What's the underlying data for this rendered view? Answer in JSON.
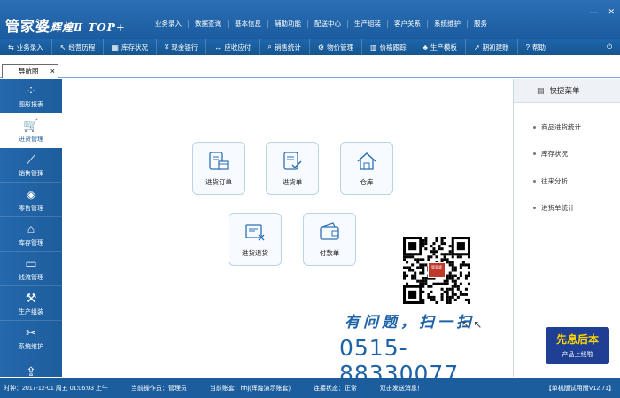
{
  "app": {
    "logo_main": "管家婆",
    "logo_sub": "辉煌Ⅱ TOP+"
  },
  "topnav": [
    "业务录入",
    "数据查询",
    "基本信息",
    "辅助功能",
    "配送中心",
    "生产组装",
    "客户关系",
    "系统维护",
    "服务"
  ],
  "toolbar": [
    {
      "icon": "clipboard-icon",
      "glyph": "⇆",
      "label": "业务录入"
    },
    {
      "icon": "route-icon",
      "glyph": "↖",
      "label": "经营历程"
    },
    {
      "icon": "warehouse-icon",
      "glyph": "▦",
      "label": "库存状况"
    },
    {
      "icon": "yen-icon",
      "glyph": "¥",
      "label": "现金银行"
    },
    {
      "icon": "exchange-icon",
      "glyph": "↔",
      "label": "应收应付"
    },
    {
      "icon": "search-icon",
      "glyph": "⌕",
      "label": "销售统计"
    },
    {
      "icon": "gear-icon",
      "glyph": "⚙",
      "label": "物价管理"
    },
    {
      "icon": "chart-icon",
      "glyph": "▥",
      "label": "价格跟踪"
    },
    {
      "icon": "sitemap-icon",
      "glyph": "♣",
      "label": "生产模板"
    },
    {
      "icon": "external-icon",
      "glyph": "↗",
      "label": "期初建账"
    },
    {
      "icon": "help-icon",
      "glyph": "?",
      "label": "帮助"
    }
  ],
  "tab": {
    "label": "导航图",
    "close": "×"
  },
  "sidebar": [
    {
      "icon": "grid-icon",
      "glyph": "⁘",
      "label": "图形报表",
      "active": false
    },
    {
      "icon": "cart-icon",
      "glyph": "🛒",
      "label": "进货管理",
      "active": true
    },
    {
      "icon": "trend-icon",
      "glyph": "⟋",
      "label": "销售管理",
      "active": false
    },
    {
      "icon": "tag-icon",
      "glyph": "◈",
      "label": "零售管理",
      "active": false
    },
    {
      "icon": "house-icon",
      "glyph": "⌂",
      "label": "库存管理",
      "active": false
    },
    {
      "icon": "card-icon",
      "glyph": "▭",
      "label": "钱流管理",
      "active": false
    },
    {
      "icon": "wrench-icon",
      "glyph": "⚒",
      "label": "生产组装",
      "active": false
    },
    {
      "icon": "tools-icon",
      "glyph": "✂",
      "label": "系统维护",
      "active": false
    },
    {
      "icon": "upload-icon",
      "glyph": "⇪",
      "label": "",
      "active": false
    }
  ],
  "tiles": [
    {
      "name": "purchase-order",
      "label": "进货订单",
      "icon": "order-box-icon"
    },
    {
      "name": "purchase-bill",
      "label": "进货单",
      "icon": "checklist-icon"
    },
    {
      "name": "warehouse",
      "label": "仓库",
      "icon": "house-icon"
    },
    {
      "name": "purchase-return",
      "label": "进货退货",
      "icon": "return-doc-icon"
    },
    {
      "name": "payment-bill",
      "label": "付款单",
      "icon": "wallet-icon"
    }
  ],
  "promo": {
    "slogan": "有问题，扫一扫",
    "phone": "0515-88330077",
    "qr_badge": "管家婆",
    "arrows": "↖ ↖",
    "title": "先息后本",
    "subtitle": "产品上线啦"
  },
  "quickmenu": {
    "title": "快捷菜单",
    "items": [
      "商品进货统计",
      "库存状况",
      "往来分析",
      "进货单统计"
    ]
  },
  "statusbar": {
    "time": "时钟：2017-12-01 周五 01:06:03 上午",
    "operator": "当前操作员：管理员",
    "account": "当前账套：hhj(辉煌演示账套)",
    "connection": "连接状态：正常",
    "message": "双击发送消息！",
    "version": "【单机版试用版V12.71】"
  },
  "colors": {
    "brand_blue": "#1d5d9c",
    "accent_text": "#1e63a8",
    "promo_yellow": "#ffd400"
  }
}
